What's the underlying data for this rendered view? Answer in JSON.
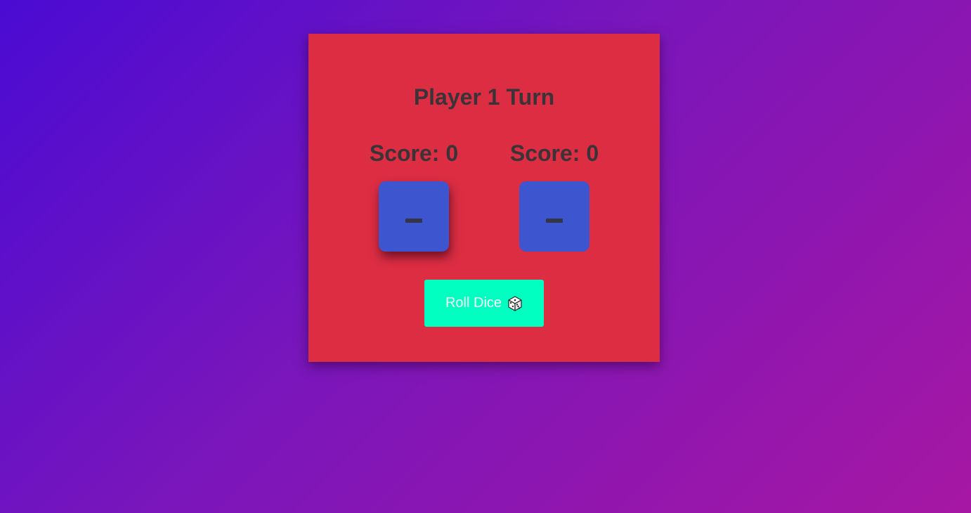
{
  "game": {
    "turn_label": "Player 1 Turn",
    "active_player": 1
  },
  "players": [
    {
      "score_label": "Score: 0",
      "die_value": "–"
    },
    {
      "score_label": "Score: 0",
      "die_value": "–"
    }
  ],
  "roll_button": {
    "label": "Roll Dice",
    "icon": "dice-icon"
  },
  "colors": {
    "background_gradient": [
      "#4a0bd3",
      "#a617a3"
    ],
    "card": "#dc2d43",
    "die": "#3d55cf",
    "button": "#00ffc0",
    "text": "#3a3439"
  }
}
